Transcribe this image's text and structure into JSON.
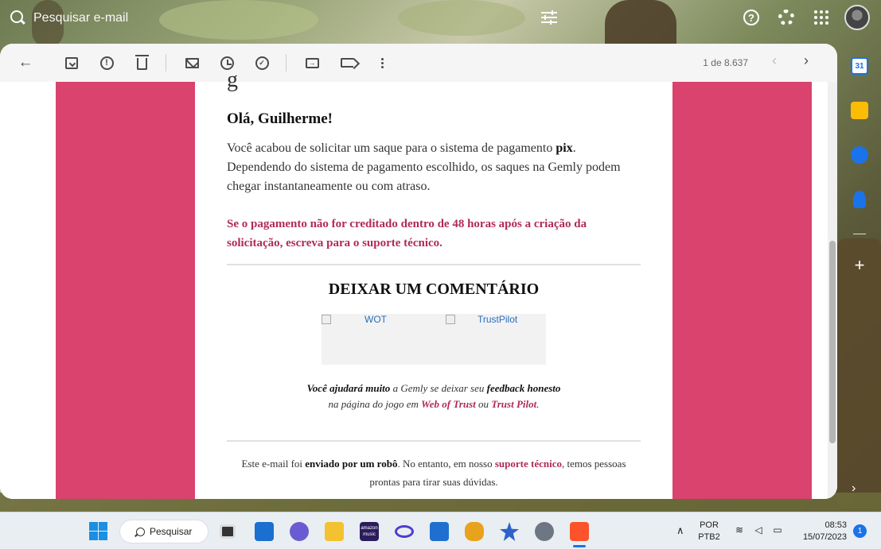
{
  "search": {
    "placeholder": "Pesquisar e-mail"
  },
  "toolbar": {
    "pager_text": "1 de 8.637",
    "prev_glyph": "‹",
    "next_glyph": "›"
  },
  "email": {
    "partial_glyph": "g",
    "greeting": "Olá, Guilherme!",
    "para_part1": "Você acabou de solicitar um saque para o sistema de pagamento ",
    "para_bold": "pix",
    "para_part2": ". Dependendo do sistema de pagamento escolhido, os saques na Gemly podem chegar instantaneamente ou com atraso.",
    "warning": "Se o pagamento não for creditado dentro de 48 horas após a criação da solicitação, escreva para o suporte técnico.",
    "comment_title": "DEIXAR UM COMENTÁRIO",
    "badge_wot": "WOT",
    "badge_trustpilot": "TrustPilot",
    "help_b1": "Você ajudará muito",
    "help_t1": " a Gemly se deixar seu ",
    "help_b2": "feedback honesto",
    "help_t2": " na página do jogo em ",
    "help_l1": "Web of Trust",
    "help_t3": " ou ",
    "help_l2": "Trust Pilot",
    "help_t4": ".",
    "footer_t1": "Este e-mail foi ",
    "footer_b1": "enviado por um robô",
    "footer_t2": ". No entanto, em nosso ",
    "footer_l1": "suporte técnico",
    "footer_t3": ", temos pessoas prontas para tirar suas dúvidas."
  },
  "side": {
    "calendar_day": "31",
    "add_glyph": "+",
    "expand_glyph": "›"
  },
  "taskbar": {
    "search_label": "Pesquisar",
    "amazon_label": "amazon music",
    "lang_line1": "POR",
    "lang_line2": "PTB2",
    "time": "08:53",
    "date": "15/07/2023",
    "notifications": "1"
  },
  "colors": {
    "accent_pink": "#d9436e",
    "link_red": "#b02a5b",
    "brand_blue": "#1a73e8"
  },
  "icons": [
    "search-icon",
    "filter-icon",
    "help-icon",
    "gear-icon",
    "apps-icon",
    "back-icon",
    "archive-icon",
    "spam-icon",
    "trash-icon",
    "mark-unread-icon",
    "snooze-icon",
    "add-task-icon",
    "move-to-icon",
    "label-icon",
    "more-icon"
  ]
}
